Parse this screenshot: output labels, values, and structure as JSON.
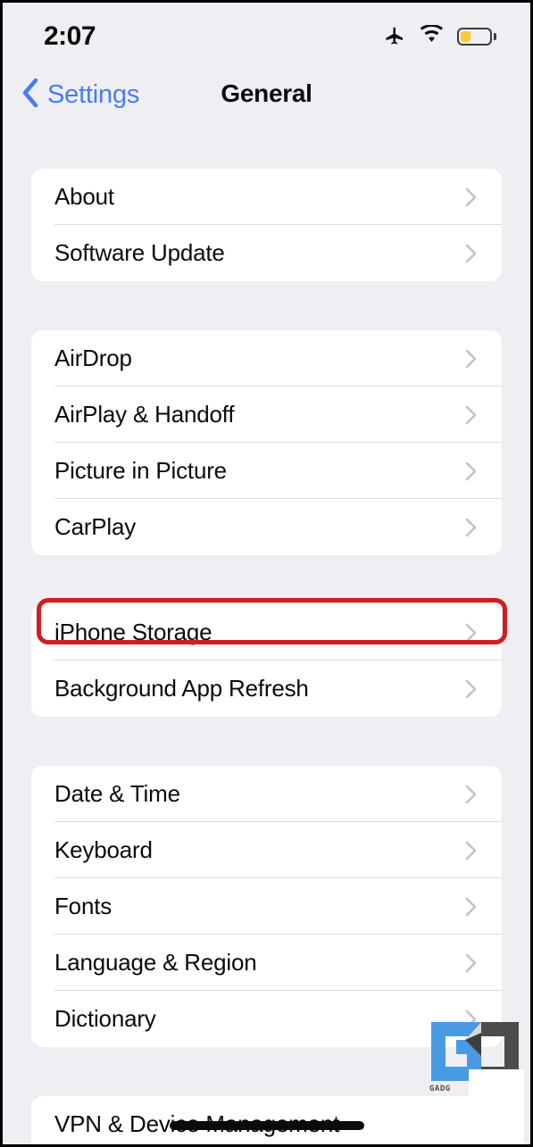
{
  "status_bar": {
    "time": "2:07",
    "icons": [
      "airplane-mode-icon",
      "wifi-icon",
      "battery-icon"
    ],
    "battery_level_percent": 36,
    "battery_color": "#fbc937"
  },
  "nav": {
    "back_label": "Settings",
    "back_icon": "chevron-left-icon",
    "title": "General",
    "accent_color": "#4a7cf0"
  },
  "sections": [
    {
      "rows": [
        {
          "label": "About",
          "accessory": "chevron-right-icon"
        },
        {
          "label": "Software Update",
          "accessory": "chevron-right-icon"
        }
      ]
    },
    {
      "rows": [
        {
          "label": "AirDrop",
          "accessory": "chevron-right-icon"
        },
        {
          "label": "AirPlay & Handoff",
          "accessory": "chevron-right-icon"
        },
        {
          "label": "Picture in Picture",
          "accessory": "chevron-right-icon"
        },
        {
          "label": "CarPlay",
          "accessory": "chevron-right-icon"
        }
      ]
    },
    {
      "rows": [
        {
          "label": "iPhone Storage",
          "accessory": "chevron-right-icon",
          "highlighted": true
        },
        {
          "label": "Background App Refresh",
          "accessory": "chevron-right-icon"
        }
      ]
    },
    {
      "rows": [
        {
          "label": "Date & Time",
          "accessory": "chevron-right-icon"
        },
        {
          "label": "Keyboard",
          "accessory": "chevron-right-icon"
        },
        {
          "label": "Fonts",
          "accessory": "chevron-right-icon"
        },
        {
          "label": "Language & Region",
          "accessory": "chevron-right-icon"
        },
        {
          "label": "Dictionary",
          "accessory": "chevron-right-icon"
        }
      ]
    },
    {
      "rows": [
        {
          "label": "VPN & Device Management",
          "accessory": "chevron-right-icon"
        }
      ]
    }
  ],
  "annotation": {
    "target_label": "iPhone Storage",
    "color": "#cd1f23",
    "shape": "rounded-rectangle-outline"
  },
  "watermark": {
    "caption": "GADG",
    "blue": "#4a9ae1",
    "gray": "#4c4c4c"
  },
  "background_color": "#efeef3",
  "card_color": "#ffffff"
}
